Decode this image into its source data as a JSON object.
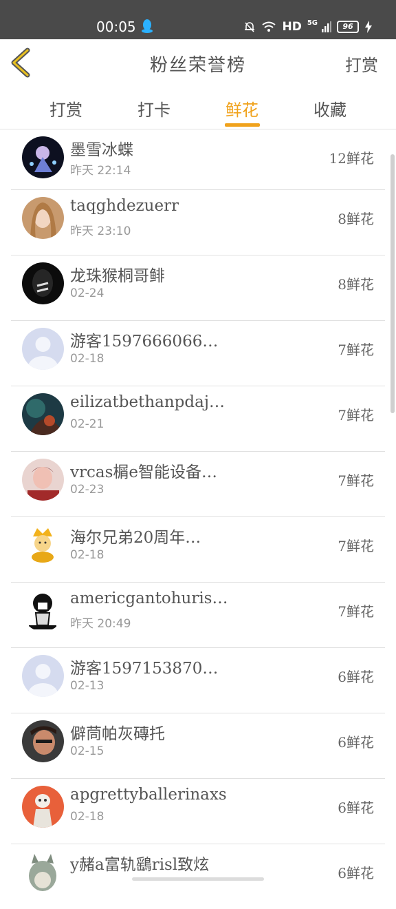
{
  "status_bar": {
    "time": "00:05",
    "network": "HD",
    "signal": "5G",
    "battery": "96"
  },
  "header": {
    "title": "粉丝荣誉榜",
    "action": "打赏"
  },
  "tabs": [
    {
      "label": "打赏",
      "active": false
    },
    {
      "label": "打卡",
      "active": false
    },
    {
      "label": "鲜花",
      "active": true
    },
    {
      "label": "收藏",
      "active": false
    }
  ],
  "accent_color": "#f0a21c",
  "fans": [
    {
      "name": "墨雪冰蝶",
      "time": "昨天 22:14",
      "count": "12鲜花"
    },
    {
      "name": "taqghdezuerr",
      "time": "昨天 23:10",
      "count": "8鲜花"
    },
    {
      "name": "龙珠猴桐哥鲱",
      "time": "02-24",
      "count": "8鲜花"
    },
    {
      "name": "游客1597666066…",
      "time": "02-18",
      "count": "7鲜花"
    },
    {
      "name": "eilizatbethanpdaj…",
      "time": "02-21",
      "count": "7鲜花"
    },
    {
      "name": "vrcas榍e智能设备…",
      "time": "02-23",
      "count": "7鲜花"
    },
    {
      "name": "海尔兄弟20周年…",
      "time": "02-18",
      "count": "7鲜花"
    },
    {
      "name": "americgantohuris…",
      "time": "昨天 20:49",
      "count": "7鲜花"
    },
    {
      "name": "游客1597153870…",
      "time": "02-13",
      "count": "6鲜花"
    },
    {
      "name": "僻茼帕灰磚托",
      "time": "02-15",
      "count": "6鲜花"
    },
    {
      "name": "apgrettyballerinaxs",
      "time": "02-18",
      "count": "6鲜花"
    },
    {
      "name": "y赭a富轨鷂risl致炫",
      "time": "",
      "count": "6鲜花"
    }
  ]
}
